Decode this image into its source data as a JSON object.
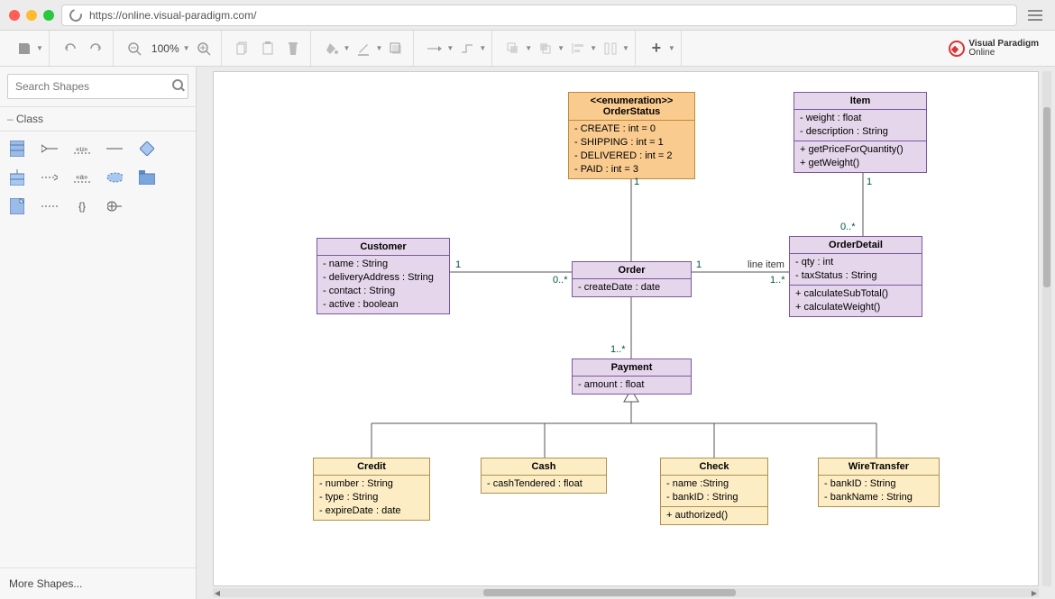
{
  "browser": {
    "url": "https://online.visual-paradigm.com/"
  },
  "toolbar": {
    "zoom": "100%",
    "logo_line1": "Visual Paradigm",
    "logo_line2": "Online"
  },
  "sidebar": {
    "search_placeholder": "Search Shapes",
    "panel_title": "Class",
    "more_shapes": "More Shapes..."
  },
  "diagram": {
    "OrderStatus": {
      "stereo": "<<enumeration>>",
      "name": "OrderStatus",
      "attrs": [
        "- CREATE : int  = 0",
        "- SHIPPING : int = 1",
        "- DELIVERED : int = 2",
        "- PAID : int = 3"
      ]
    },
    "Item": {
      "name": "Item",
      "attrs": [
        "- weight : float",
        "- description : String"
      ],
      "ops": [
        "+ getPriceForQuantity()",
        "+ getWeight()"
      ]
    },
    "Customer": {
      "name": "Customer",
      "attrs": [
        "- name : String",
        "- deliveryAddress : String",
        "- contact : String",
        "- active : boolean"
      ]
    },
    "Order": {
      "name": "Order",
      "attrs": [
        "- createDate : date"
      ]
    },
    "OrderDetail": {
      "name": "OrderDetail",
      "attrs": [
        "- qty : int",
        "- taxStatus : String"
      ],
      "ops": [
        "+ calculateSubTotal()",
        "+ calculateWeight()"
      ]
    },
    "Payment": {
      "name": "Payment",
      "attrs": [
        "- amount : float"
      ]
    },
    "Credit": {
      "name": "Credit",
      "attrs": [
        "- number : String",
        "- type : String",
        "- expireDate : date"
      ]
    },
    "Cash": {
      "name": "Cash",
      "attrs": [
        "- cashTendered : float"
      ]
    },
    "Check": {
      "name": "Check",
      "attrs": [
        "- name :String",
        "- bankID : String"
      ],
      "ops": [
        "+ authorized()"
      ]
    },
    "WireTransfer": {
      "name": "WireTransfer",
      "attrs": [
        "- bankID : String",
        "- bankName : String"
      ]
    },
    "labels": {
      "os_order_top": "1",
      "cust_order_left": "1",
      "cust_order_right": "0..*",
      "order_detail_left": "1",
      "order_detail_right": "1..*",
      "lineitem": "line item",
      "item_detail_top": "1",
      "item_detail_bot": "0..*",
      "order_pay": "1..*"
    }
  }
}
